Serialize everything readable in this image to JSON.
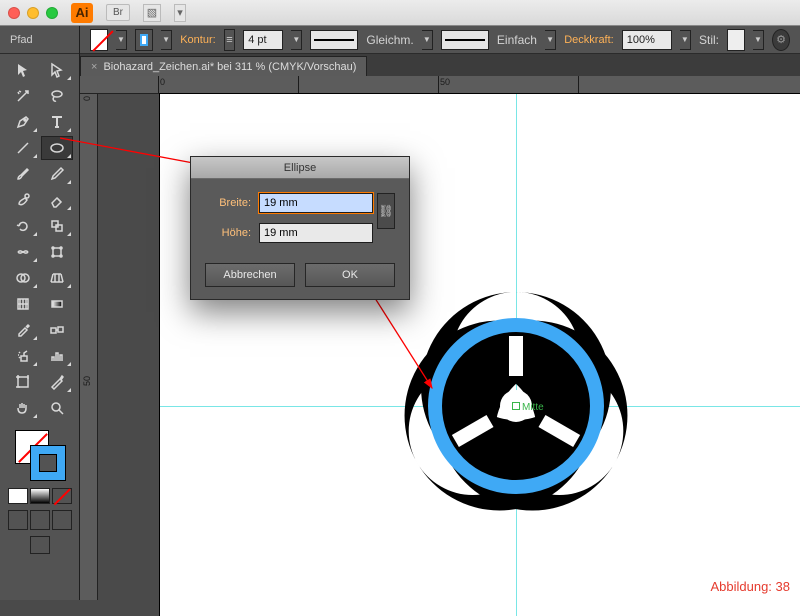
{
  "window": {
    "app_badge": "Ai",
    "br_badge": "Br"
  },
  "controlbar": {
    "path_label": "Pfad",
    "kontur_label": "Kontur:",
    "stroke_weight": "4 pt",
    "cap_label": "Gleichm.",
    "profile_label": "Einfach",
    "opacity_label": "Deckkraft:",
    "opacity_value": "100%",
    "style_label": "Stil:"
  },
  "doc_tab": {
    "title": "Biohazard_Zeichen.ai* bei 311 % (CMYK/Vorschau)",
    "close": "×"
  },
  "ruler": {
    "h": [
      "0",
      "50"
    ],
    "v": [
      "0",
      "50"
    ]
  },
  "dialog": {
    "title": "Ellipse",
    "width_label": "Breite:",
    "width_value": "19 mm",
    "height_label": "Höhe:",
    "height_value": "19 mm",
    "cancel": "Abbrechen",
    "ok": "OK"
  },
  "canvas": {
    "center_label": "Mitte"
  },
  "caption": "Abbildung: 38",
  "colors": {
    "accent_blue": "#3fa9f5",
    "accent_orange": "#ff7b00"
  }
}
